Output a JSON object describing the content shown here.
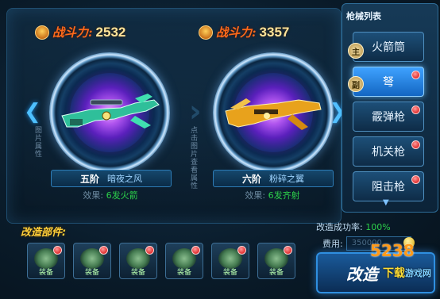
{
  "left_weapon": {
    "power_label": "战斗力:",
    "power_value": "2532",
    "tier": "五阶",
    "name": "暗夜之风",
    "effect_label": "效果:",
    "effect_value": "6发火箭",
    "side_note": "图片属性"
  },
  "right_weapon": {
    "power_label": "战斗力:",
    "power_value": "3357",
    "tier": "六阶",
    "name": "粉碎之翼",
    "effect_label": "效果:",
    "effect_value": "6发齐射",
    "side_note": "点击图片查看属性"
  },
  "gun_list": {
    "title": "枪械列表",
    "items": [
      {
        "label": "火箭筒",
        "tag": "主"
      },
      {
        "label": "弩",
        "tag": "副"
      },
      {
        "label": "霰弹枪"
      },
      {
        "label": "机关枪"
      },
      {
        "label": "阻击枪"
      }
    ]
  },
  "mods": {
    "title": "改造部件:",
    "slots": [
      "装备",
      "装备",
      "装备",
      "装备",
      "装备",
      "装备"
    ]
  },
  "upgrade": {
    "rate_label": "改造成功率:",
    "rate_value": "100%",
    "cost_label": "费用:",
    "cost_value": "350000",
    "button_label": "改造"
  },
  "watermark": {
    "number": "5238",
    "download": "下载",
    "site": "游戏网"
  },
  "colors": {
    "accent": "#2f8fe0",
    "power_label": "#ff6a1a",
    "effect_value": "#2cd04a",
    "title_gold": "#ffcf3a"
  }
}
